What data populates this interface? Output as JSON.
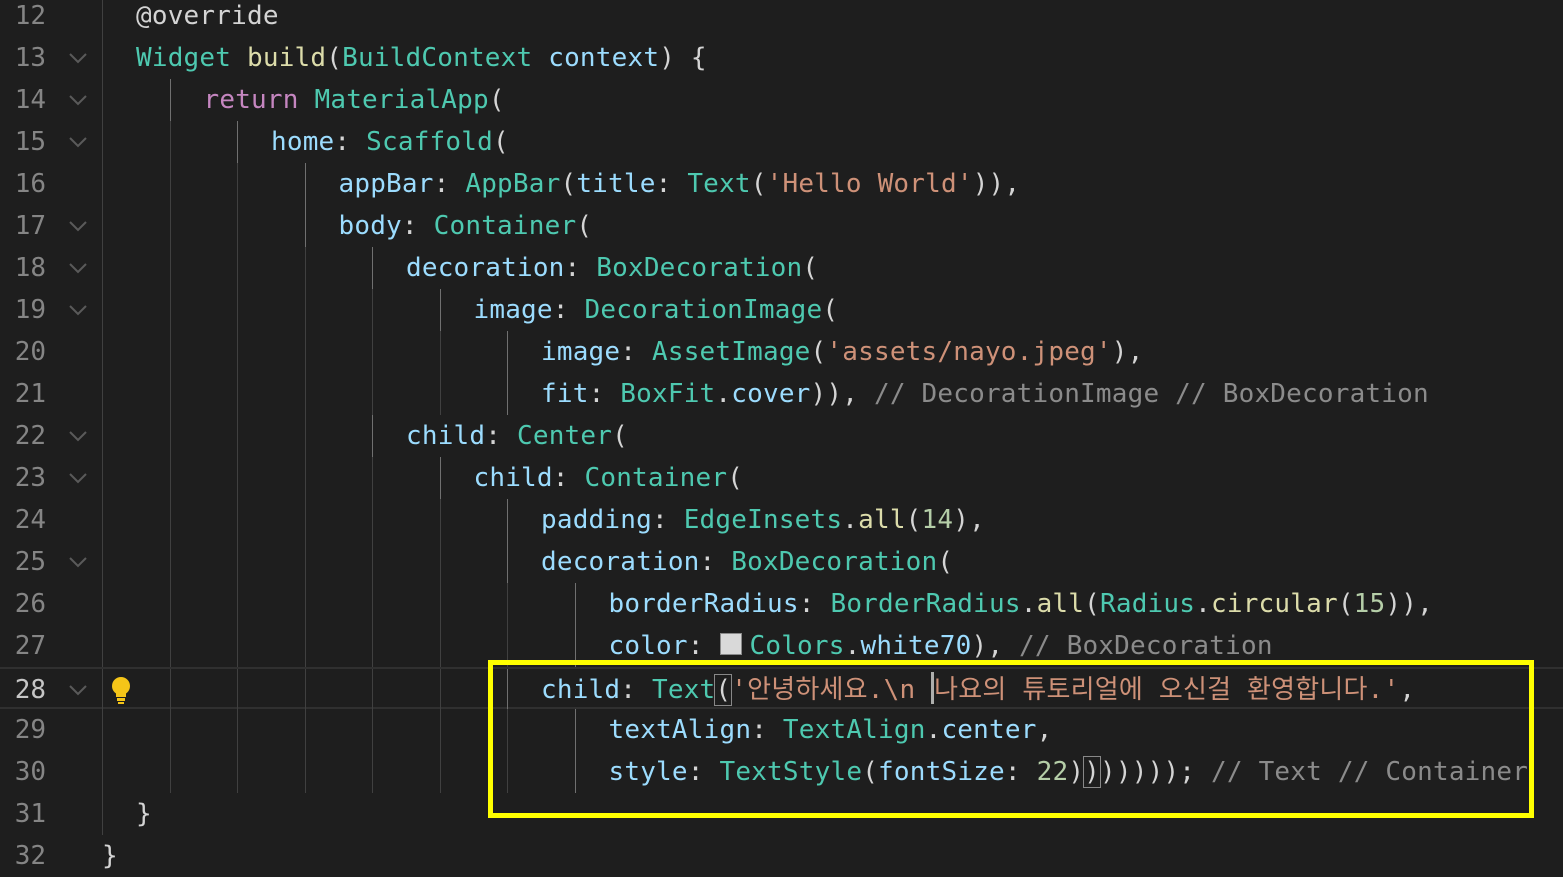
{
  "editor": {
    "active_line": 28,
    "lines": [
      {
        "n": "12",
        "indent": 1,
        "tokens": [
          {
            "t": "@override",
            "c": "t-meta"
          }
        ]
      },
      {
        "n": "13",
        "indent": 1,
        "fold": true,
        "tokens": [
          {
            "t": "Widget ",
            "c": "t-type"
          },
          {
            "t": "build",
            "c": "t-fn"
          },
          {
            "t": "(",
            "c": "t-punc"
          },
          {
            "t": "BuildContext ",
            "c": "t-type"
          },
          {
            "t": "context",
            "c": "t-var"
          },
          {
            "t": ") {",
            "c": "t-punc"
          }
        ]
      },
      {
        "n": "14",
        "indent": 2,
        "fold": true,
        "tokens": [
          {
            "t": "return ",
            "c": "t-kw"
          },
          {
            "t": "MaterialApp",
            "c": "t-type"
          },
          {
            "t": "(",
            "c": "t-punc"
          }
        ]
      },
      {
        "n": "15",
        "indent": 3,
        "fold": true,
        "tokens": [
          {
            "t": "home",
            "c": "t-var"
          },
          {
            "t": ": ",
            "c": "t-punc"
          },
          {
            "t": "Scaffold",
            "c": "t-type"
          },
          {
            "t": "(",
            "c": "t-punc"
          }
        ]
      },
      {
        "n": "16",
        "indent": 4,
        "tokens": [
          {
            "t": "appBar",
            "c": "t-var"
          },
          {
            "t": ": ",
            "c": "t-punc"
          },
          {
            "t": "AppBar",
            "c": "t-type"
          },
          {
            "t": "(",
            "c": "t-punc"
          },
          {
            "t": "title",
            "c": "t-var"
          },
          {
            "t": ": ",
            "c": "t-punc"
          },
          {
            "t": "Text",
            "c": "t-type"
          },
          {
            "t": "(",
            "c": "t-punc"
          },
          {
            "t": "'Hello World'",
            "c": "t-str"
          },
          {
            "t": ")),",
            "c": "t-punc"
          }
        ]
      },
      {
        "n": "17",
        "indent": 4,
        "fold": true,
        "tokens": [
          {
            "t": "body",
            "c": "t-var"
          },
          {
            "t": ": ",
            "c": "t-punc"
          },
          {
            "t": "Container",
            "c": "t-type"
          },
          {
            "t": "(",
            "c": "t-punc"
          }
        ]
      },
      {
        "n": "18",
        "indent": 5,
        "fold": true,
        "tokens": [
          {
            "t": "decoration",
            "c": "t-var"
          },
          {
            "t": ": ",
            "c": "t-punc"
          },
          {
            "t": "BoxDecoration",
            "c": "t-type"
          },
          {
            "t": "(",
            "c": "t-punc"
          }
        ]
      },
      {
        "n": "19",
        "indent": 6,
        "fold": true,
        "tokens": [
          {
            "t": "image",
            "c": "t-var"
          },
          {
            "t": ": ",
            "c": "t-punc"
          },
          {
            "t": "DecorationImage",
            "c": "t-type"
          },
          {
            "t": "(",
            "c": "t-punc"
          }
        ]
      },
      {
        "n": "20",
        "indent": 7,
        "tokens": [
          {
            "t": "image",
            "c": "t-var"
          },
          {
            "t": ": ",
            "c": "t-punc"
          },
          {
            "t": "AssetImage",
            "c": "t-type"
          },
          {
            "t": "(",
            "c": "t-punc"
          },
          {
            "t": "'assets/nayo.jpeg'",
            "c": "t-str"
          },
          {
            "t": "),",
            "c": "t-punc"
          }
        ]
      },
      {
        "n": "21",
        "indent": 7,
        "tokens": [
          {
            "t": "fit",
            "c": "t-var"
          },
          {
            "t": ": ",
            "c": "t-punc"
          },
          {
            "t": "BoxFit",
            "c": "t-type"
          },
          {
            "t": ".",
            "c": "t-punc"
          },
          {
            "t": "cover",
            "c": "t-var"
          },
          {
            "t": ")), ",
            "c": "t-punc"
          },
          {
            "t": "// DecorationImage // BoxDecoration",
            "c": "t-hint"
          }
        ]
      },
      {
        "n": "22",
        "indent": 5,
        "fold": true,
        "tokens": [
          {
            "t": "child",
            "c": "t-var"
          },
          {
            "t": ": ",
            "c": "t-punc"
          },
          {
            "t": "Center",
            "c": "t-type"
          },
          {
            "t": "(",
            "c": "t-punc"
          }
        ]
      },
      {
        "n": "23",
        "indent": 6,
        "fold": true,
        "tokens": [
          {
            "t": "child",
            "c": "t-var"
          },
          {
            "t": ": ",
            "c": "t-punc"
          },
          {
            "t": "Container",
            "c": "t-type"
          },
          {
            "t": "(",
            "c": "t-punc"
          }
        ]
      },
      {
        "n": "24",
        "indent": 7,
        "tokens": [
          {
            "t": "padding",
            "c": "t-var"
          },
          {
            "t": ": ",
            "c": "t-punc"
          },
          {
            "t": "EdgeInsets",
            "c": "t-type"
          },
          {
            "t": ".",
            "c": "t-punc"
          },
          {
            "t": "all",
            "c": "t-fn"
          },
          {
            "t": "(",
            "c": "t-punc"
          },
          {
            "t": "14",
            "c": "t-num"
          },
          {
            "t": "),",
            "c": "t-punc"
          }
        ]
      },
      {
        "n": "25",
        "indent": 7,
        "fold": true,
        "tokens": [
          {
            "t": "decoration",
            "c": "t-var"
          },
          {
            "t": ": ",
            "c": "t-punc"
          },
          {
            "t": "BoxDecoration",
            "c": "t-type"
          },
          {
            "t": "(",
            "c": "t-punc"
          }
        ]
      },
      {
        "n": "26",
        "indent": 8,
        "tokens": [
          {
            "t": "borderRadius",
            "c": "t-var"
          },
          {
            "t": ": ",
            "c": "t-punc"
          },
          {
            "t": "BorderRadius",
            "c": "t-type"
          },
          {
            "t": ".",
            "c": "t-punc"
          },
          {
            "t": "all",
            "c": "t-fn"
          },
          {
            "t": "(",
            "c": "t-punc"
          },
          {
            "t": "Radius",
            "c": "t-type"
          },
          {
            "t": ".",
            "c": "t-punc"
          },
          {
            "t": "circular",
            "c": "t-fn"
          },
          {
            "t": "(",
            "c": "t-punc"
          },
          {
            "t": "15",
            "c": "t-num"
          },
          {
            "t": ")),",
            "c": "t-punc"
          }
        ]
      },
      {
        "n": "27",
        "indent": 8,
        "tokens": [
          {
            "t": "color",
            "c": "t-var"
          },
          {
            "t": ": ",
            "c": "t-punc"
          },
          {
            "t": "",
            "c": "swatch"
          },
          {
            "t": "Colors",
            "c": "t-type"
          },
          {
            "t": ".",
            "c": "t-punc"
          },
          {
            "t": "white70",
            "c": "t-var"
          },
          {
            "t": "), ",
            "c": "t-punc"
          },
          {
            "t": "// BoxDecoration",
            "c": "t-hint"
          }
        ]
      },
      {
        "n": "28",
        "indent": 7,
        "fold": true,
        "bulb": true,
        "tokens": [
          {
            "t": "child",
            "c": "t-var"
          },
          {
            "t": ": ",
            "c": "t-punc"
          },
          {
            "t": "Text",
            "c": "t-type"
          },
          {
            "t": "(",
            "c": "t-punc bracket-box"
          },
          {
            "t": "'안녕하세요.\\n ",
            "c": "t-str"
          },
          {
            "t": "",
            "c": "cursor"
          },
          {
            "t": "나요의 튜토리얼에 오신걸 환영합니다.'",
            "c": "t-str"
          },
          {
            "t": ",",
            "c": "t-punc"
          }
        ]
      },
      {
        "n": "29",
        "indent": 8,
        "tokens": [
          {
            "t": "textAlign",
            "c": "t-var"
          },
          {
            "t": ": ",
            "c": "t-punc"
          },
          {
            "t": "TextAlign",
            "c": "t-type"
          },
          {
            "t": ".",
            "c": "t-punc"
          },
          {
            "t": "center",
            "c": "t-var"
          },
          {
            "t": ",",
            "c": "t-punc"
          }
        ]
      },
      {
        "n": "30",
        "indent": 8,
        "tokens": [
          {
            "t": "style",
            "c": "t-var"
          },
          {
            "t": ": ",
            "c": "t-punc"
          },
          {
            "t": "TextStyle",
            "c": "t-type"
          },
          {
            "t": "(",
            "c": "t-punc"
          },
          {
            "t": "fontSize",
            "c": "t-var"
          },
          {
            "t": ": ",
            "c": "t-punc"
          },
          {
            "t": "22",
            "c": "t-num"
          },
          {
            "t": ")",
            "c": "t-punc"
          },
          {
            "t": ")",
            "c": "t-punc bracket-box"
          },
          {
            "t": "))))); ",
            "c": "t-punc"
          },
          {
            "t": "// Text // Container",
            "c": "t-hint"
          }
        ]
      },
      {
        "n": "31",
        "indent": 1,
        "tokens": [
          {
            "t": "}",
            "c": "t-punc"
          }
        ]
      },
      {
        "n": "32",
        "indent": 0,
        "tokens": [
          {
            "t": "}",
            "c": "t-punc"
          }
        ]
      }
    ]
  }
}
